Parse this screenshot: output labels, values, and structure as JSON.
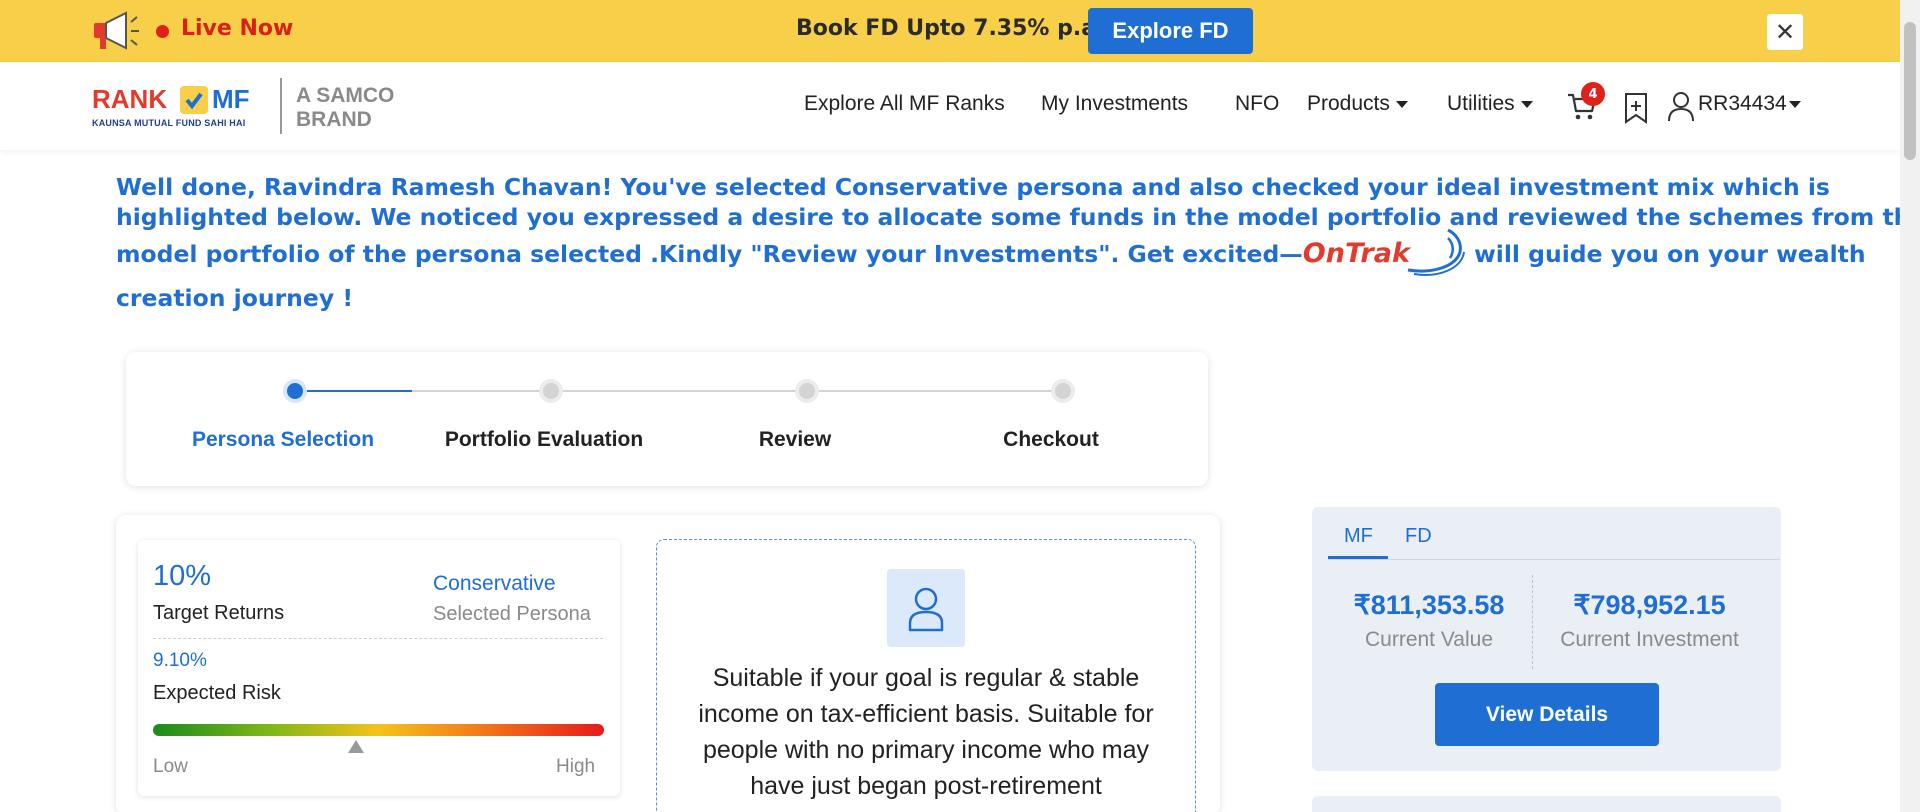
{
  "banner": {
    "live_label": "Live Now",
    "offer_text": "Book FD Upto 7.35% p.a.",
    "cta_label": "Explore FD",
    "close_label": "✕",
    "colors": {
      "background": "#f8cf48",
      "live": "#d9201a",
      "cta": "#1f6ed4"
    }
  },
  "logo": {
    "rank": "RANK",
    "mf": "MF",
    "tagline": "KAUNSA MUTUAL FUND SAHI HAI",
    "samco_line1": "A SAMCO",
    "samco_line2": "BRAND"
  },
  "nav": {
    "items": [
      "Explore All MF Ranks",
      "My Investments",
      "NFO",
      "Products",
      "Utilities"
    ],
    "cart_count": "4",
    "user_id": "RR34434",
    "icons": [
      "cart-icon",
      "bookmark-plus-icon",
      "user-icon"
    ]
  },
  "message": {
    "line1": "Well done, Ravindra Ramesh Chavan! You've selected Conservative persona and also checked your ideal investment mix which is",
    "line2": "highlighted below. We noticed you expressed a desire to allocate some funds in the model portfolio and reviewed the schemes from the",
    "line3_before": "model portfolio of the persona selected .Kindly \"Review your Investments\". Get excited—",
    "ontrak": "OnTrak",
    "line3_after": " will guide you on your wealth",
    "line4": "creation journey !"
  },
  "stepper": {
    "steps": [
      "Persona Selection",
      "Portfolio Evaluation",
      "Review",
      "Checkout"
    ],
    "active_index": 0
  },
  "persona": {
    "target_returns_value": "10%",
    "target_returns_label": "Target Returns",
    "persona_value": "Conservative",
    "persona_label": "Selected Persona",
    "risk_value": "9.10%",
    "risk_label": "Expected Risk",
    "risk_level": 0.45,
    "low_label": "Low",
    "high_label": "High",
    "description": "Suitable if your goal is regular & stable income on tax-efficient basis. Suitable for people with no primary income who may have just began post-retirement"
  },
  "holdings": {
    "tabs": [
      "MF",
      "FD"
    ],
    "active_tab": "MF",
    "current_value": "₹811,353.58",
    "current_value_label": "Current Value",
    "current_investment": "₹798,952.15",
    "current_investment_label": "Current Investment",
    "button_label": "View Details"
  }
}
